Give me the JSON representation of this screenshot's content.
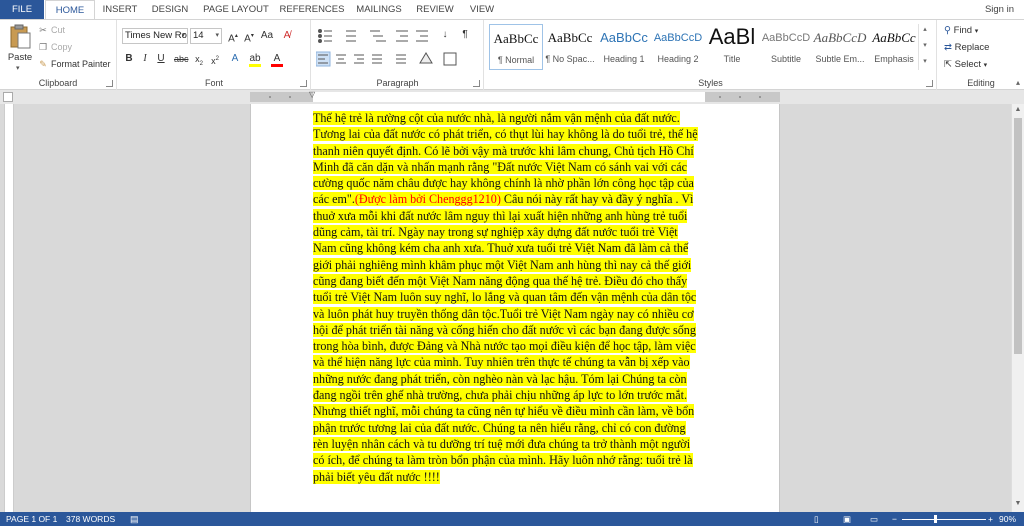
{
  "tabs": [
    {
      "label": "FILE"
    },
    {
      "label": "HOME"
    },
    {
      "label": "INSERT"
    },
    {
      "label": "DESIGN"
    },
    {
      "label": "PAGE LAYOUT"
    },
    {
      "label": "REFERENCES"
    },
    {
      "label": "MAILINGS"
    },
    {
      "label": "REVIEW"
    },
    {
      "label": "VIEW"
    }
  ],
  "signin": "Sign in",
  "clipboard": {
    "paste": "Paste",
    "cut": "Cut",
    "copy": "Copy",
    "format_painter": "Format Painter",
    "group_label": "Clipboard"
  },
  "font": {
    "font_name": "Times New Ro",
    "font_size": "14",
    "group_label": "Font"
  },
  "paragraph": {
    "group_label": "Paragraph"
  },
  "styles": {
    "group_label": "Styles",
    "items": [
      {
        "sample": "AaBbCc",
        "name": "¶ Normal"
      },
      {
        "sample": "AaBbCc",
        "name": "¶ No Spac..."
      },
      {
        "sample": "AaBbCc",
        "name": "Heading 1"
      },
      {
        "sample": "AaBbCcD",
        "name": "Heading 2"
      },
      {
        "sample": "AaBl",
        "name": "Title"
      },
      {
        "sample": "AaBbCcD",
        "name": "Subtitle"
      },
      {
        "sample": "AaBbCcD",
        "name": "Subtle Em..."
      },
      {
        "sample": "AaBbCc",
        "name": "Emphasis"
      }
    ]
  },
  "editing": {
    "find": "Find",
    "replace": "Replace",
    "select": "Select",
    "group_label": "Editing"
  },
  "document": {
    "lines": [
      [
        "Thế hệ trẻ là rường cột của nước nhà, là người nắm vận mệnh của đất nước."
      ],
      [
        "Tương lai của đất nước có phát triển, có thụt lùi hay không là do tuổi trẻ, thế hệ"
      ],
      [
        "thanh niên quyết định. Có lẽ bởi vậy mà trước khi lâm chung, Chủ tịch Hồ Chí"
      ],
      [
        "Minh đã căn dặn và nhấn mạnh rằng \"Đất nước Việt Nam có sánh vai với các"
      ],
      [
        "cường quốc năm châu được hay không chính là nhờ phần lớn công học tập của"
      ],
      [
        "các em\"."
      ],
      [
        "thuở xưa mỗi khi đất nước lâm nguy thì lại xuất hiện những anh hùng trẻ tuổi"
      ],
      [
        "dũng cảm, tài trí. Ngày nay trong sự nghiệp xây dựng đất nước tuổi trẻ Việt"
      ],
      [
        "Nam cũng không kém cha anh xưa. Thuở xưa tuổi trẻ Việt Nam đã làm cả thế"
      ],
      [
        "giới phải nghiêng mình khâm phục một Việt Nam anh hùng thì nay cả thế giới"
      ],
      [
        "cũng đang biết đến một Việt Nam năng động qua thế hệ trẻ. Điều đó cho thấy"
      ],
      [
        "tuổi trẻ Việt Nam luôn suy nghĩ, lo lắng và quan tâm đến vận mệnh của dân tộc"
      ],
      [
        "và luôn phát huy truyền thống dân tộc.Tuổi trẻ Việt Nam ngày nay có nhiều cơ"
      ],
      [
        "hội để phát triển tài năng và cống hiến cho đất nước vì các bạn đang được sống"
      ],
      [
        "trong hòa bình, được Đảng và Nhà nước tạo mọi điều kiện để học tập, làm việc"
      ],
      [
        "và thể hiện năng lực của mình.  Tuy nhiên trên thực tế chúng ta vẫn bị xếp vào"
      ],
      [
        "những nước đang phát triển, còn nghèo nàn và lạc hậu.  Tóm lại Chúng ta còn"
      ],
      [
        "đang ngồi trên ghế nhà trường, chưa phải chịu những áp lực to lớn trước mắt."
      ],
      [
        "Nhưng thiết nghĩ, mỗi chúng ta cũng nên tự hiểu về điều mình cần làm, về bổn"
      ],
      [
        "phận trước tương lai của đất nước. Chúng ta nên hiểu rằng, chỉ có con đường"
      ],
      [
        "rèn luyện nhân cách và tu dưỡng trí tuệ mới đưa chúng ta trở thành một người"
      ],
      [
        "có ích, để chúng ta làm tròn bổn phận của mình. Hãy luôn nhớ rằng: tuổi trẻ là"
      ],
      [
        "phải biết yêu đất nước !!!!"
      ]
    ],
    "red_text": "(Được làm bởi Chenggg1210)",
    "after_red": " Câu nói này rất hay và đầy ý nghĩa . Vì"
  },
  "status": {
    "page": "PAGE 1 OF 1",
    "words": "378 WORDS",
    "zoom": "90%"
  },
  "colors": {
    "accent": "#2b579a",
    "highlight": "#ffff00",
    "red_text": "#ff0000"
  }
}
